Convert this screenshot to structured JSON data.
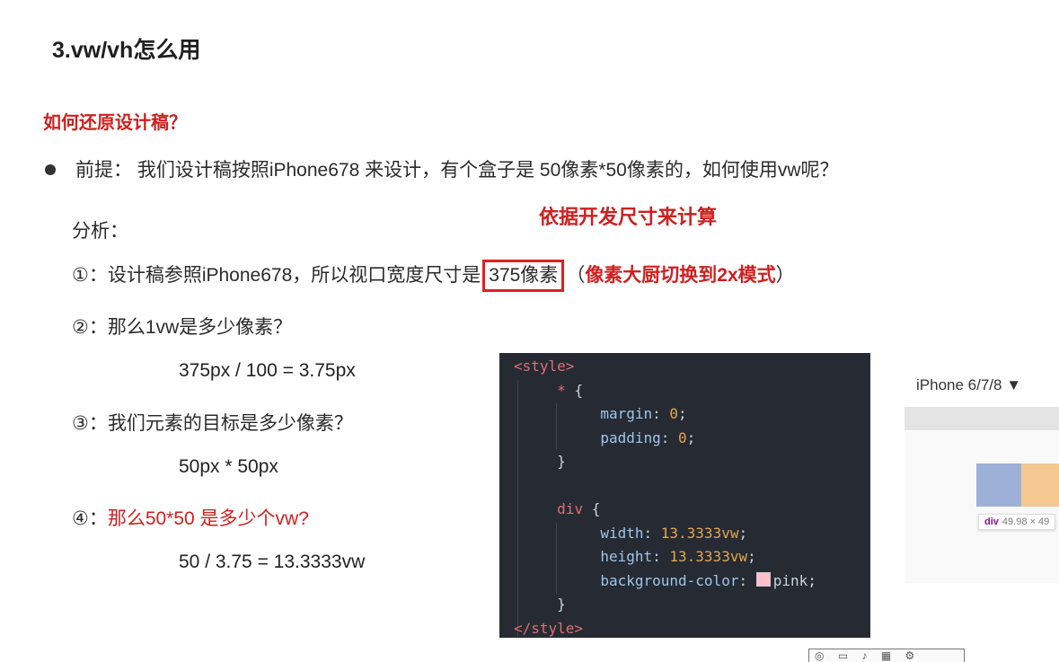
{
  "title": "3.vw/vh怎么用",
  "question": "如何还原设计稿？",
  "premise": "前提： 我们设计稿按照iPhone678 来设计，有个盒子是 50像素*50像素的，如何使用vw呢？",
  "basis_note": "依据开发尺寸来计算",
  "analysis_label": "分析：",
  "steps": {
    "s1_prefix": "①：设计稿参照iPhone678，所以视口宽度尺寸是",
    "s1_box": "375像素",
    "s1_paren_open": "（",
    "s1_note": "像素大厨切换到2x模式",
    "s1_paren_close": "）",
    "s2": "②：那么1vw是多少像素？",
    "s2_calc": "375px / 100  =  3.75px",
    "s3": "③：我们元素的目标是多少像素？",
    "s3_calc": "50px * 50px",
    "s4_prefix": "④：",
    "s4_red": "那么50*50 是多少个vw?",
    "s4_calc": "50 / 3.75  =  13.3333vw"
  },
  "code": {
    "open_tag": "<style>",
    "star": "*",
    "lbrace": "{",
    "margin_prop": "margin",
    "margin_val": "0",
    "padding_prop": "padding",
    "padding_val": "0",
    "rbrace": "}",
    "div_sel": "div",
    "width_prop": "width",
    "width_val": "13.3333vw",
    "height_prop": "height",
    "height_val": "13.3333vw",
    "bg_prop": "background-color",
    "bg_val": "pink",
    "close_tag": "</style>"
  },
  "preview": {
    "device": "iPhone 6/7/8 ▼",
    "tip_tag": "div",
    "tip_size": "49.98 × 49"
  },
  "colors": {
    "accent_red": "#d01f1f",
    "code_bg": "#262b33",
    "pink": "#ffc0cb"
  }
}
